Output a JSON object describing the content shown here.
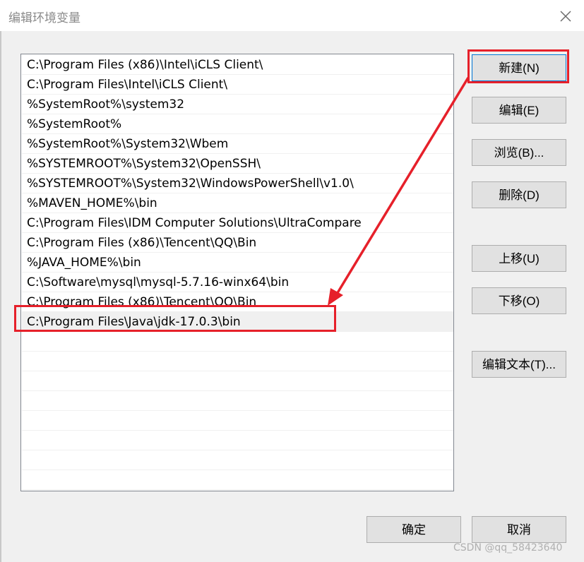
{
  "window": {
    "title": "编辑环境变量"
  },
  "path_list": {
    "items": [
      "C:\\Program Files (x86)\\Intel\\iCLS Client\\",
      "C:\\Program Files\\Intel\\iCLS Client\\",
      "%SystemRoot%\\system32",
      "%SystemRoot%",
      "%SystemRoot%\\System32\\Wbem",
      "%SYSTEMROOT%\\System32\\OpenSSH\\",
      "%SYSTEMROOT%\\System32\\WindowsPowerShell\\v1.0\\",
      "%MAVEN_HOME%\\bin",
      "C:\\Program Files\\IDM Computer Solutions\\UltraCompare",
      "C:\\Program Files (x86)\\Tencent\\QQ\\Bin",
      "%JAVA_HOME%\\bin",
      "C:\\Software\\mysql\\mysql-5.7.16-winx64\\bin",
      "C:\\Program Files (x86)\\Tencent\\QQ\\Bin",
      "C:\\Program Files\\Java\\jdk-17.0.3\\bin"
    ],
    "selected_index": 13
  },
  "buttons": {
    "new": "新建(N)",
    "edit": "编辑(E)",
    "browse": "浏览(B)...",
    "delete": "删除(D)",
    "move_up": "上移(U)",
    "move_down": "下移(O)",
    "edit_text": "编辑文本(T)...",
    "ok": "确定",
    "cancel": "取消"
  },
  "annotation": {
    "color": "#e6202a"
  },
  "watermark": "CSDN @qq_58423640"
}
